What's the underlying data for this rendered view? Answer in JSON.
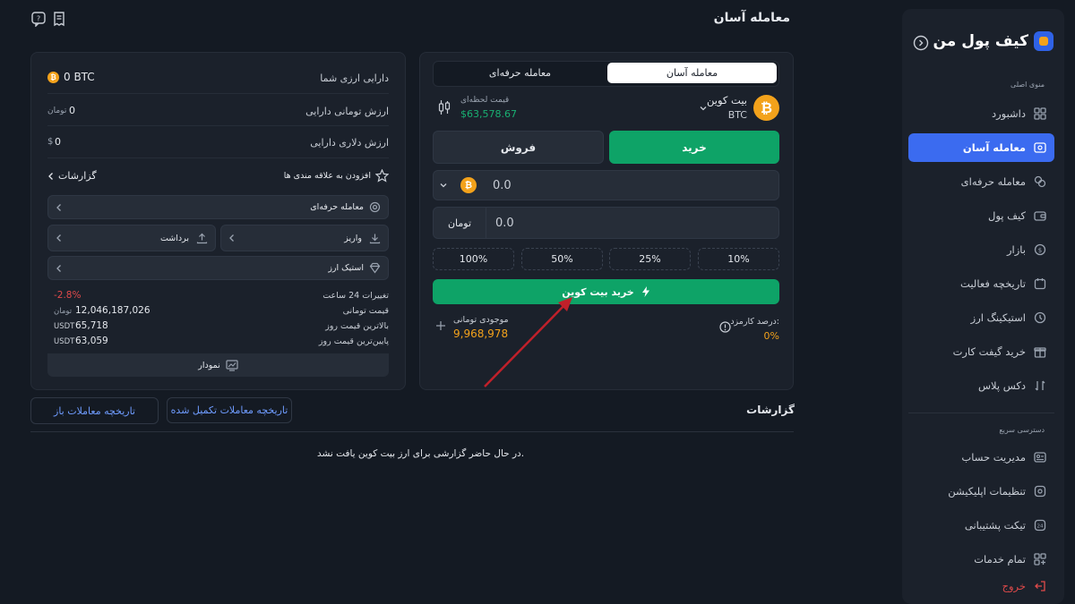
{
  "header": {
    "title": "معامله آسان"
  },
  "sidebar": {
    "brand": "کیف پول من",
    "section_main": "منوی اصلی",
    "section_quick": "دسترسی سریع",
    "items": [
      {
        "label": "داشبورد",
        "icon": "dashboard-icon"
      },
      {
        "label": "معامله آسان",
        "icon": "easy-trade-icon",
        "active": true
      },
      {
        "label": "معامله حرفه‌ای",
        "icon": "pro-trade-icon"
      },
      {
        "label": "کیف پول",
        "icon": "wallet-icon"
      },
      {
        "label": "بازار",
        "icon": "market-icon"
      },
      {
        "label": "تاریخچه فعالیت",
        "icon": "history-icon"
      },
      {
        "label": "استیکینگ ارز",
        "icon": "staking-icon"
      },
      {
        "label": "خرید گیفت کارت",
        "icon": "gift-card-icon"
      },
      {
        "label": "دکس پلاس",
        "icon": "dex-plus-icon"
      }
    ],
    "quick": [
      {
        "label": "مدیریت حساب",
        "icon": "account-icon"
      },
      {
        "label": "تنظیمات اپلیکیشن",
        "icon": "settings-icon"
      },
      {
        "label": "تیکت پشتیبانی",
        "icon": "support-icon"
      },
      {
        "label": "تمام خدمات",
        "icon": "all-services-icon"
      }
    ],
    "logout": "خروج"
  },
  "trade": {
    "tabs": {
      "easy": "معامله آسان",
      "pro": "معامله حرفه‌ای"
    },
    "coin_name": "بیت کوین",
    "coin_symbol": "BTC",
    "live_price_label": "قیمت لحظه‌ای",
    "live_price": "$63,578.67",
    "buy_label": "خرید",
    "sell_label": "فروش",
    "crypto_amount": "0.0",
    "toman_amount": "0.0",
    "toman_label": "تومان",
    "percents": [
      "100%",
      "50%",
      "25%",
      "10%"
    ],
    "submit_label": "خرید بیت کوین",
    "balance_label": "موجودی تومانی",
    "balance_value": "9,968,978",
    "fee_label": "درصد کارمزد:",
    "fee_value": "0%"
  },
  "assets": {
    "crypto_label": "دارایی ارزی شما",
    "crypto_value": "0 BTC",
    "toman_label": "ارزش تومانی دارایی",
    "toman_value": "0",
    "toman_unit": "تومان",
    "dollar_label": "ارزش دلاری دارایی",
    "dollar_value": "0",
    "dollar_unit": "$",
    "favorites_label": "افزودن به علاقه مندی ها",
    "reports_link": "گزارشات",
    "pro_trade": "معامله حرفه‌ای",
    "deposit": "واریز",
    "withdraw": "برداشت",
    "staking": "استیک ارز",
    "stats": [
      {
        "label": "تغییرات 24 ساعت",
        "value": "-2.8%",
        "unit": ""
      },
      {
        "label": "قیمت تومانی",
        "value": "12,046,187,026",
        "unit": "تومان"
      },
      {
        "label": "بالاترین قیمت روز",
        "value": "65,718",
        "unit": "USDT"
      },
      {
        "label": "پایین‌ترین قیمت روز",
        "value": "63,059",
        "unit": "USDT"
      }
    ],
    "chart_button": "نمودار"
  },
  "reports": {
    "title": "گزارشات",
    "completed_history": "تاریخچه معاملات تکمیل شده",
    "open_history": "تاریخچه معاملات باز",
    "empty_message": "در حال حاضر گزارشی برای ارز بیت کوین یافت نشد."
  },
  "colors": {
    "background": "#141a23",
    "panel": "#1b212b",
    "accent_blue": "#3b6bf0",
    "buy_green": "#0ea367",
    "price_green": "#19b072",
    "balance_gold": "#f3a21b",
    "negative_red": "#e04a4a"
  }
}
